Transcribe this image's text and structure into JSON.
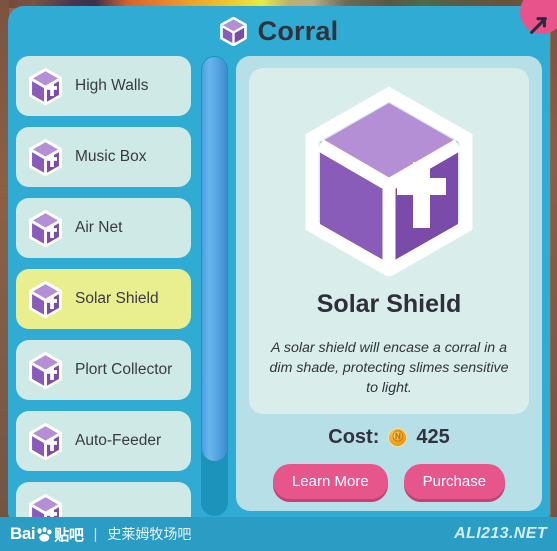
{
  "header": {
    "title": "Corral",
    "icon": "cube-icon",
    "close_icon": "close-x-icon"
  },
  "sidebar": {
    "items": [
      {
        "label": "High Walls",
        "icon": "cube-plus-icon",
        "selected": false
      },
      {
        "label": "Music Box",
        "icon": "cube-plus-icon",
        "selected": false
      },
      {
        "label": "Air Net",
        "icon": "cube-plus-icon",
        "selected": false
      },
      {
        "label": "Solar Shield",
        "icon": "cube-plus-icon",
        "selected": true
      },
      {
        "label": "Plort Collector",
        "icon": "cube-plus-icon",
        "selected": false
      },
      {
        "label": "Auto-Feeder",
        "icon": "cube-plus-icon",
        "selected": false
      },
      {
        "label": "",
        "icon": "cube-plus-icon",
        "selected": false
      }
    ],
    "scrollbar": "vertical-scrollbar"
  },
  "detail": {
    "icon": "cube-plus-icon",
    "title": "Solar Shield",
    "description": "A solar shield will encase a corral in a dim shade, protecting slimes sensitive to light.",
    "cost_label": "Cost:",
    "cost_value": "425",
    "coin_icon": "newbuck-coin-icon",
    "learn_more_label": "Learn More",
    "purchase_label": "Purchase"
  },
  "watermark": {
    "baidu": "Bai",
    "paw_icon": "baidu-paw-icon",
    "tieba": "贴吧",
    "separator": "|",
    "forum": "史莱姆牧场吧",
    "site": "ALI213.NET"
  },
  "colors": {
    "panel": "#2fabd4",
    "list_item": "#cfeae6",
    "list_item_selected": "#e9ef8e",
    "detail_panel": "#b7dfe8",
    "detail_card": "#d9eeea",
    "button": "#e6568a",
    "close": "#e8538c",
    "coin": "#f5a623",
    "scrollbar_thumb": "#4f9fdd"
  }
}
